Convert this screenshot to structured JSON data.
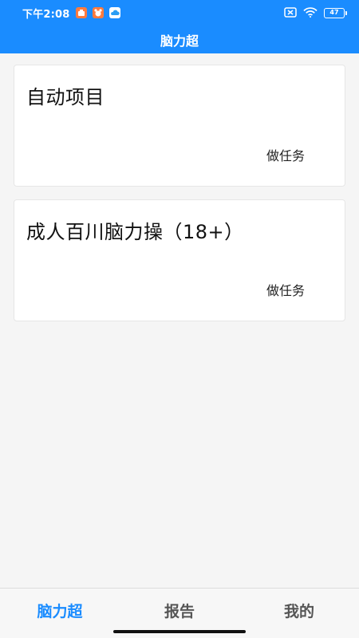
{
  "status_bar": {
    "time": "下午2:08",
    "notification_icons": [
      "app-notification-icon",
      "app-notification-icon",
      "cloud-icon"
    ],
    "battery_level": "47"
  },
  "header": {
    "title": "脑力超"
  },
  "tasks": [
    {
      "title": "自动项目",
      "action_label": "做任务"
    },
    {
      "title": "成人百川脑力操（18+）",
      "action_label": "做任务"
    }
  ],
  "bottom_nav": {
    "items": [
      {
        "label": "脑力超",
        "active": true
      },
      {
        "label": "报告",
        "active": false
      },
      {
        "label": "我的",
        "active": false
      }
    ]
  },
  "colors": {
    "accent": "#1a8cff",
    "background": "#f5f5f5",
    "card": "#ffffff",
    "nav_inactive": "#555555"
  }
}
